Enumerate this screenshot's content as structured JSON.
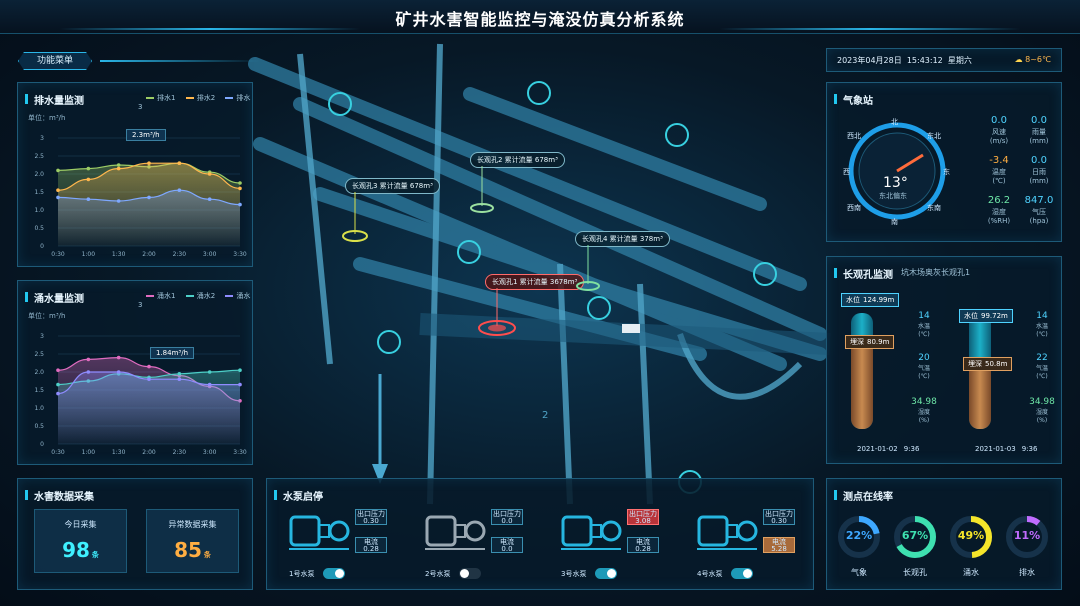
{
  "header": {
    "title": "矿井水害智能监控与淹没仿真分析系统"
  },
  "menu": {
    "label": "功能菜单"
  },
  "datetime": {
    "date": "2023年04月28日",
    "time": "15:43:12",
    "weekday": "星期六",
    "temperature": "8~6℃",
    "weather_icon": "partly-cloudy-icon"
  },
  "drainage": {
    "title": "排水量监测",
    "unit": "单位：m³/h",
    "legend": [
      "排水1",
      "排水2",
      "排水3"
    ],
    "tooltip": "2.3m³/h",
    "chart_data": {
      "type": "area",
      "x": [
        "0:30",
        "1:00",
        "1:30",
        "2:00",
        "2:30",
        "3:00",
        "3:30"
      ],
      "ylim": [
        0,
        3
      ],
      "yticks": [
        "0",
        "0.5",
        "1.0",
        "1.5",
        "2.0",
        "2.5",
        "3"
      ],
      "series": [
        {
          "name": "排水1",
          "values": [
            2.1,
            2.15,
            2.25,
            2.2,
            2.3,
            2.05,
            1.75
          ],
          "color": "#9ccc65"
        },
        {
          "name": "排水2",
          "values": [
            1.55,
            1.85,
            2.15,
            2.3,
            2.3,
            2.0,
            1.6
          ],
          "color": "#ffb74d"
        },
        {
          "name": "排水3",
          "values": [
            1.35,
            1.3,
            1.25,
            1.35,
            1.55,
            1.3,
            1.15
          ],
          "color": "#7ea8ff"
        }
      ]
    }
  },
  "inflow": {
    "title": "涌水量监测",
    "unit": "单位：m³/h",
    "legend": [
      "涌水1",
      "涌水2",
      "涌水3"
    ],
    "tooltip": "1.84m³/h",
    "chart_data": {
      "type": "area",
      "x": [
        "0:30",
        "1:00",
        "1:30",
        "2:00",
        "2:30",
        "3:00",
        "3:30"
      ],
      "ylim": [
        0,
        3
      ],
      "yticks": [
        "0",
        "0.5",
        "1.0",
        "1.5",
        "2.0",
        "2.5",
        "3"
      ],
      "series": [
        {
          "name": "涌水1",
          "values": [
            2.05,
            2.35,
            2.4,
            2.15,
            1.9,
            1.6,
            1.2
          ],
          "color": "#e06cc0"
        },
        {
          "name": "涌水2",
          "values": [
            1.65,
            1.75,
            1.95,
            1.85,
            1.95,
            2.0,
            2.05
          ],
          "color": "#4dd0c8"
        },
        {
          "name": "涌水3",
          "values": [
            1.4,
            2.0,
            2.0,
            1.8,
            1.8,
            1.65,
            1.65
          ],
          "color": "#8f8cff"
        }
      ]
    }
  },
  "collect": {
    "title": "水害数据采集",
    "today_label": "今日采集",
    "today_value": "98",
    "today_unit": "条",
    "abnormal_label": "异常数据采集",
    "abnormal_value": "85",
    "abnormal_unit": "条"
  },
  "pumps": {
    "title": "水泵启停",
    "out_label": "出口压力",
    "cur_label": "电流",
    "items": [
      {
        "name": "1号水泵",
        "pressure": "0.30",
        "current": "0.28",
        "on": true,
        "alert": ""
      },
      {
        "name": "2号水泵",
        "pressure": "0.0",
        "current": "0.0",
        "on": false,
        "alert": ""
      },
      {
        "name": "3号水泵",
        "pressure": "3.08",
        "current": "0.28",
        "on": true,
        "alert": "pressure"
      },
      {
        "name": "4号水泵",
        "pressure": "0.30",
        "current": "5.28",
        "on": true,
        "alert": "current"
      }
    ]
  },
  "weather": {
    "title": "气象站",
    "compass": {
      "n": "北",
      "ne": "东北",
      "e": "东",
      "se": "东南",
      "s": "南",
      "sw": "西南",
      "w": "西",
      "nw": "西北"
    },
    "wind_temp": "13°",
    "wind_dir": "东北偏东",
    "stats": [
      {
        "value": "0.0",
        "label": "风速\n(m/s)",
        "color": "#4fd3ff"
      },
      {
        "value": "0.0",
        "label": "雨量\n(mm)",
        "color": "#4fd3ff"
      },
      {
        "value": "-3.4",
        "label": "温度\n(℃)",
        "color": "#ffae42"
      },
      {
        "value": "0.0",
        "label": "日雨\n(mm)",
        "color": "#4fd3ff"
      },
      {
        "value": "26.2",
        "label": "湿度\n(%RH)",
        "color": "#6ee7a8"
      },
      {
        "value": "847.0",
        "label": "气压\n(hpa)",
        "color": "#4fd3ff"
      }
    ]
  },
  "borehole": {
    "title": "长观孔监测",
    "subtitle": "坑木场奥灰长观孔1",
    "items": [
      {
        "level_label": "水位",
        "level": "124.99m",
        "depth_label": "埋深",
        "depth": "80.9m",
        "water_temp": "14",
        "water_temp_label": "水温\n(℃)",
        "air_temp": "20",
        "air_temp_label": "气温\n(℃)",
        "humidity": "34.98",
        "humidity_label": "湿度\n(%)",
        "date": "2021-01-02",
        "time": "9:36"
      },
      {
        "level_label": "水位",
        "level": "99.72m",
        "depth_label": "埋深",
        "depth": "50.8m",
        "water_temp": "14",
        "water_temp_label": "水温\n(℃)",
        "air_temp": "22",
        "air_temp_label": "气温\n(℃)",
        "humidity": "34.98",
        "humidity_label": "湿度\n(%)",
        "date": "2021-01-03",
        "time": "9:36"
      }
    ]
  },
  "online": {
    "title": "测点在线率",
    "items": [
      {
        "value": "22%",
        "pct": 22,
        "label": "气象",
        "color": "#3ea8ff"
      },
      {
        "value": "67%",
        "pct": 67,
        "label": "长观孔",
        "color": "#3ee0b0"
      },
      {
        "value": "49%",
        "pct": 49,
        "label": "涌水",
        "color": "#f5e52a"
      },
      {
        "value": "11%",
        "pct": 11,
        "label": "排水",
        "color": "#c06cff"
      }
    ]
  },
  "scene": {
    "callouts": [
      {
        "text": "长观孔3  累计流量  678m³"
      },
      {
        "text": "长观孔2  累计流量  678m³"
      },
      {
        "text": "长观孔4  累计流量  378m³"
      },
      {
        "text": "长观孔1  累计流量  3678m³",
        "alert": true
      }
    ],
    "marker_label": "2"
  }
}
